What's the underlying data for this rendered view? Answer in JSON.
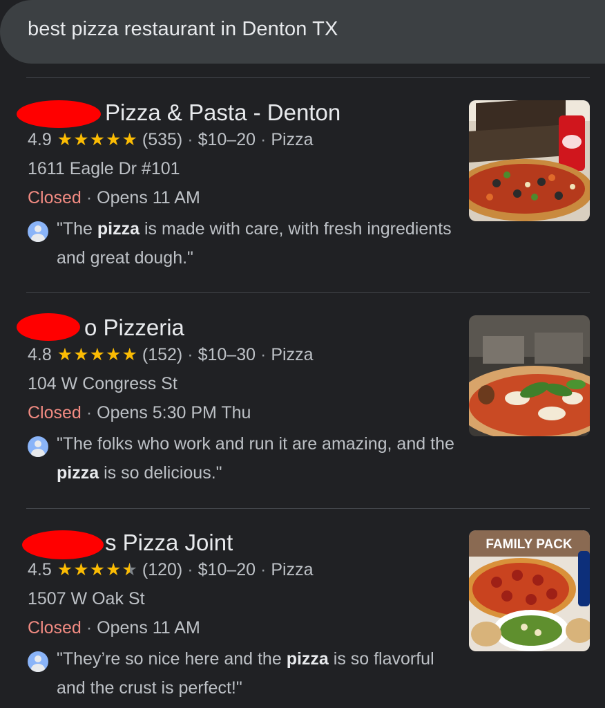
{
  "search": {
    "query": "best pizza restaurant in Denton TX"
  },
  "results": [
    {
      "title_visible": "Pizza & Pasta - Denton",
      "rating": "4.9",
      "stars": 5,
      "reviews": "(535)",
      "price": "$10–20",
      "category": "Pizza",
      "address": "1611 Eagle Dr #101",
      "status": "Closed",
      "hours": "Opens 11 AM",
      "snippet_pre": "\"The ",
      "snippet_bold": "pizza",
      "snippet_post": " is made with care, with fresh ingredients and great dough.\"",
      "image_icon": "pizza-photo"
    },
    {
      "title_visible": "o Pizzeria",
      "rating": "4.8",
      "stars": 5,
      "reviews": "(152)",
      "price": "$10–30",
      "category": "Pizza",
      "address": "104 W Congress St",
      "status": "Closed",
      "hours": "Opens 5:30 PM Thu",
      "snippet_pre": "\"The folks who work and run it are amazing, and the ",
      "snippet_bold": "pizza",
      "snippet_post": " is so delicious.\"",
      "image_icon": "margherita-photo"
    },
    {
      "title_visible": "s Pizza Joint",
      "rating": "4.5",
      "stars": 4.5,
      "reviews": "(120)",
      "price": "$10–20",
      "category": "Pizza",
      "address": "1507 W Oak St",
      "status": "Closed",
      "hours": "Opens 11 AM",
      "snippet_pre": "\"They’re so nice here and the ",
      "snippet_bold": "pizza",
      "snippet_post": " is so flavorful and the crust is perfect!\"",
      "image_icon": "family-pack-photo",
      "image_caption": "FAMILY PACK"
    }
  ],
  "separator": "·",
  "colors": {
    "background": "#202124",
    "search_bar": "#3c4043",
    "star": "#fbbc04",
    "closed": "#f28b82",
    "redaction": "#ff0000"
  }
}
